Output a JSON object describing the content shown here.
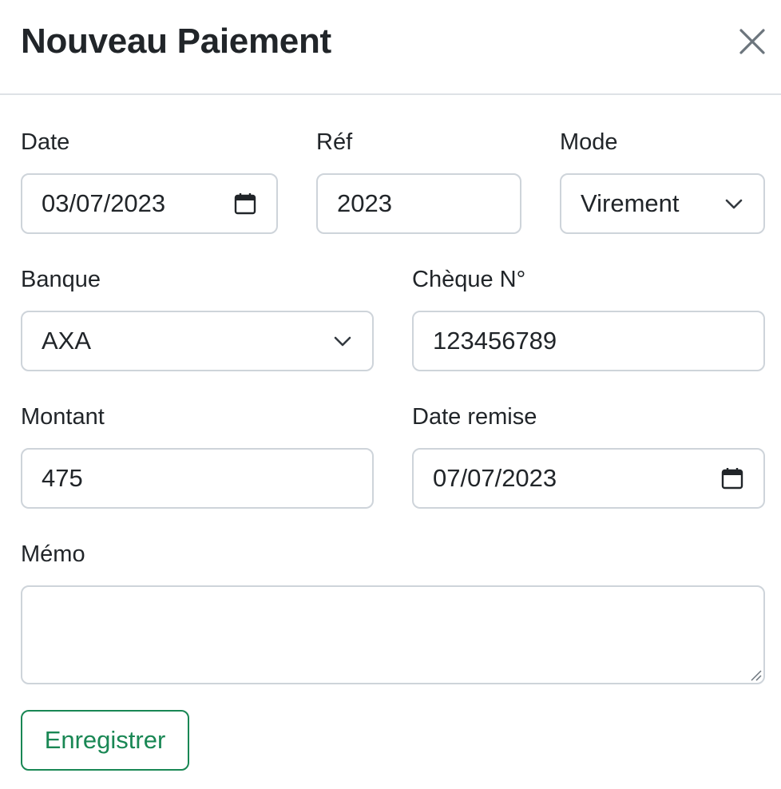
{
  "header": {
    "title": "Nouveau Paiement",
    "close_icon": "close-icon"
  },
  "form": {
    "date": {
      "label": "Date",
      "value": "03/07/2023",
      "icon": "calendar-icon"
    },
    "ref": {
      "label": "Réf",
      "value": "2023"
    },
    "mode": {
      "label": "Mode",
      "value": "Virement",
      "icon": "chevron-down-icon"
    },
    "banque": {
      "label": "Banque",
      "value": "AXA",
      "icon": "chevron-down-icon"
    },
    "cheque": {
      "label": "Chèque N°",
      "value": "123456789"
    },
    "montant": {
      "label": "Montant",
      "value": "475"
    },
    "date_remise": {
      "label": "Date remise",
      "value": "07/07/2023",
      "icon": "calendar-icon"
    },
    "memo": {
      "label": "Mémo",
      "value": ""
    }
  },
  "actions": {
    "save_label": "Enregistrer"
  },
  "colors": {
    "save_button": "#198754",
    "input_border": "#ced4da",
    "text": "#212529"
  }
}
